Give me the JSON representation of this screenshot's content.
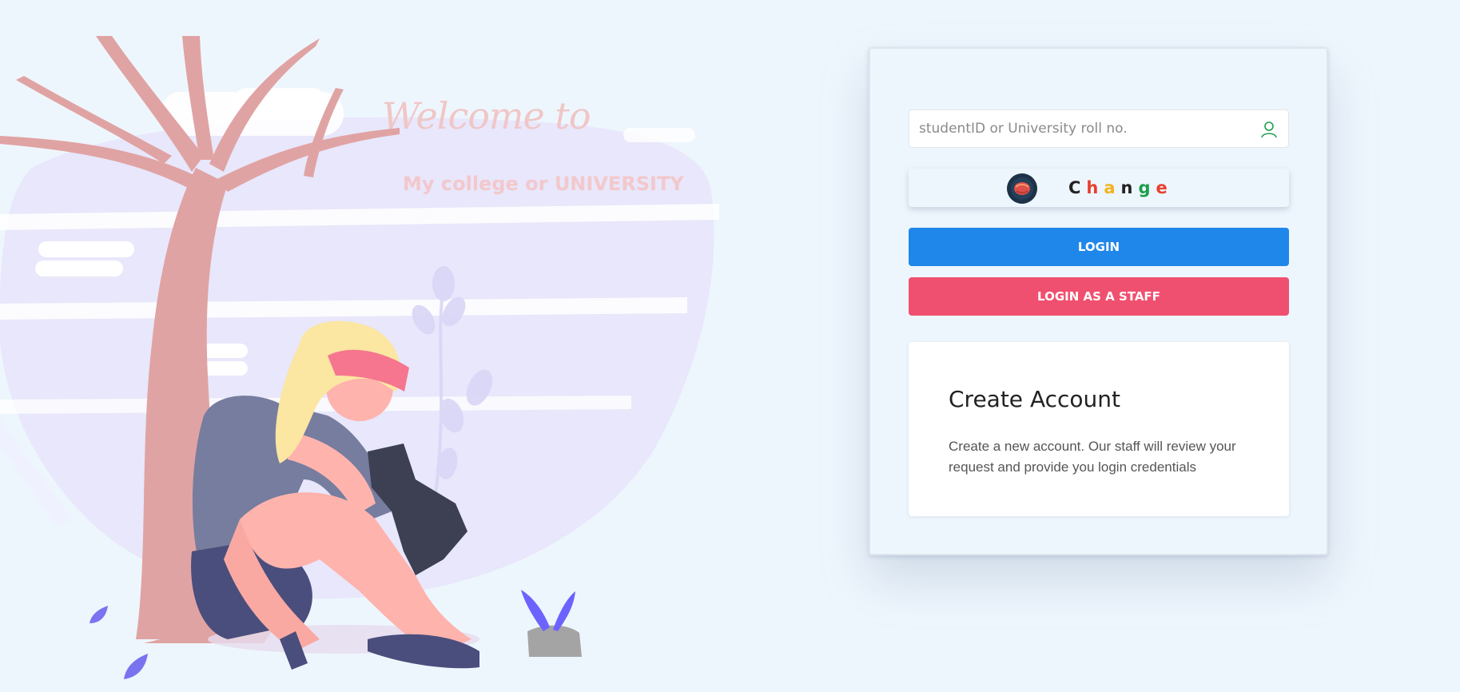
{
  "hero": {
    "welcome": "Welcome to",
    "subtitle": "My college or UNIVERSITY"
  },
  "login": {
    "id_placeholder": "studentID or University roll no.",
    "captcha_word": [
      "C",
      "h",
      "a",
      "n",
      "g",
      "e"
    ],
    "captcha_colors": [
      "#222222",
      "#e8402f",
      "#f2b320",
      "#222222",
      "#1e9e4a",
      "#e8402f"
    ],
    "login_label": "LOGIN",
    "staff_label": "LOGIN AS A STAFF"
  },
  "create": {
    "title": "Create Account",
    "description": "Create a new account. Our staff will review your request and provide you login credentials"
  },
  "colors": {
    "primary": "#1f87ea",
    "staff": "#f0506f",
    "icon_green": "#1e9e4a"
  },
  "icons": {
    "field": "user-icon",
    "captcha": "captcha-logo-icon"
  }
}
